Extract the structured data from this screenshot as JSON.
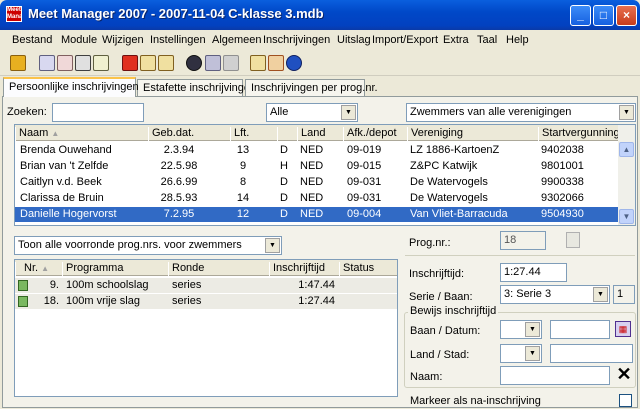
{
  "window": {
    "title": "Meet Manager 2007 - 2007-11-04 C-klasse 3.mdb",
    "app_icon_text": "Meet Manager",
    "controls": [
      "_",
      "□",
      "×"
    ]
  },
  "menu": [
    "Bestand",
    "Module",
    "Wijzigen",
    "Instellingen",
    "Algemeen",
    "Inschrijvingen",
    "Uitslag",
    "Import/Export",
    "Extra",
    "Taal",
    "Help"
  ],
  "tabs": [
    "Persoonlijke inschrijvingen",
    "Estafette inschrijvingen",
    "Inschrijvingen per prog.nr."
  ],
  "filter": {
    "search_label": "Zoeken:",
    "search_value": "",
    "gender_value": "Alle",
    "club_value": "Zwemmers van alle verenigingen"
  },
  "swimmers": {
    "columns": [
      "Naam",
      "Geb.dat.",
      "Lft.",
      "",
      "Land",
      "Afk./depot",
      "Vereniging",
      "Startvergunning"
    ],
    "rows": [
      [
        "Brenda Ouwehand",
        "2.3.94",
        "13",
        "D",
        "NED",
        "09-019",
        "LZ 1886-KartoenZ",
        "9402038"
      ],
      [
        "Brian van 't Zelfde",
        "22.5.98",
        "9",
        "H",
        "NED",
        "09-015",
        "Z&PC Katwijk",
        "9801001"
      ],
      [
        "Caitlyn v.d. Beek",
        "26.6.99",
        "8",
        "D",
        "NED",
        "09-031",
        "De Watervogels",
        "9900338"
      ],
      [
        "Clarissa de Bruin",
        "28.5.93",
        "14",
        "D",
        "NED",
        "09-031",
        "De Watervogels",
        "9302066"
      ],
      [
        "Danielle Hogervorst",
        "7.2.95",
        "12",
        "D",
        "NED",
        "09-004",
        "Van Vliet-Barracuda",
        "9504930"
      ]
    ],
    "selected_index": 4
  },
  "prog_filter": "Toon alle voorronde prog.nrs. voor zwemmers",
  "entries": {
    "columns": [
      "Nr.",
      "Programma",
      "Ronde",
      "Inschrijftijd",
      "Status"
    ],
    "rows": [
      [
        "9.",
        "100m schoolslag",
        "series",
        "1:47.44",
        ""
      ],
      [
        "18.",
        "100m vrije slag",
        "series",
        "1:27.44",
        ""
      ]
    ]
  },
  "detail": {
    "prog_label": "Prog.nr.:",
    "prog_value": "18",
    "time_label": "Inschrijftijd:",
    "time_value": "1:27.44",
    "heat_label": "Serie / Baan:",
    "heat_value": "3: Serie 3",
    "lane_value": "1",
    "proof_title": "Bewijs inschrijftijd",
    "lane_date_label": "Baan / Datum:",
    "country_city_label": "Land / Stad:",
    "name_label": "Naam:",
    "late_entry_label": "Markeer als na-inschrijving"
  }
}
